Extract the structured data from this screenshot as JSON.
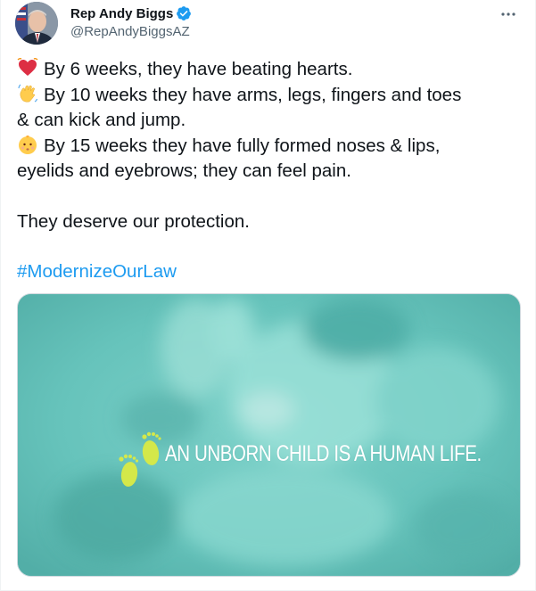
{
  "author": {
    "display_name": "Rep Andy Biggs",
    "handle": "@RepAndyBiggsAZ",
    "verified": true
  },
  "tweet": {
    "lines": [
      {
        "emoji": "heart-icon",
        "text": "By 6 weeks, they have beating hearts."
      },
      {
        "emoji": "waving-hand-icon",
        "text": "By 10 weeks they have arms, legs, fingers and toes"
      },
      {
        "emoji": null,
        "text": "& can kick and jump."
      },
      {
        "emoji": "baby-face-icon",
        "text": "By 15 weeks they have fully formed noses & lips,"
      },
      {
        "emoji": null,
        "text": "eyelids and eyebrows; they can feel pain."
      }
    ],
    "closing": "They deserve our protection.",
    "hashtag": "#ModernizeOurLaw"
  },
  "media": {
    "caption": "AN UNBORN CHILD IS A HUMAN LIFE."
  },
  "colors": {
    "link": "#1d9bf0",
    "media_teal": "#67c2bb",
    "feet": "#d4e84a"
  }
}
